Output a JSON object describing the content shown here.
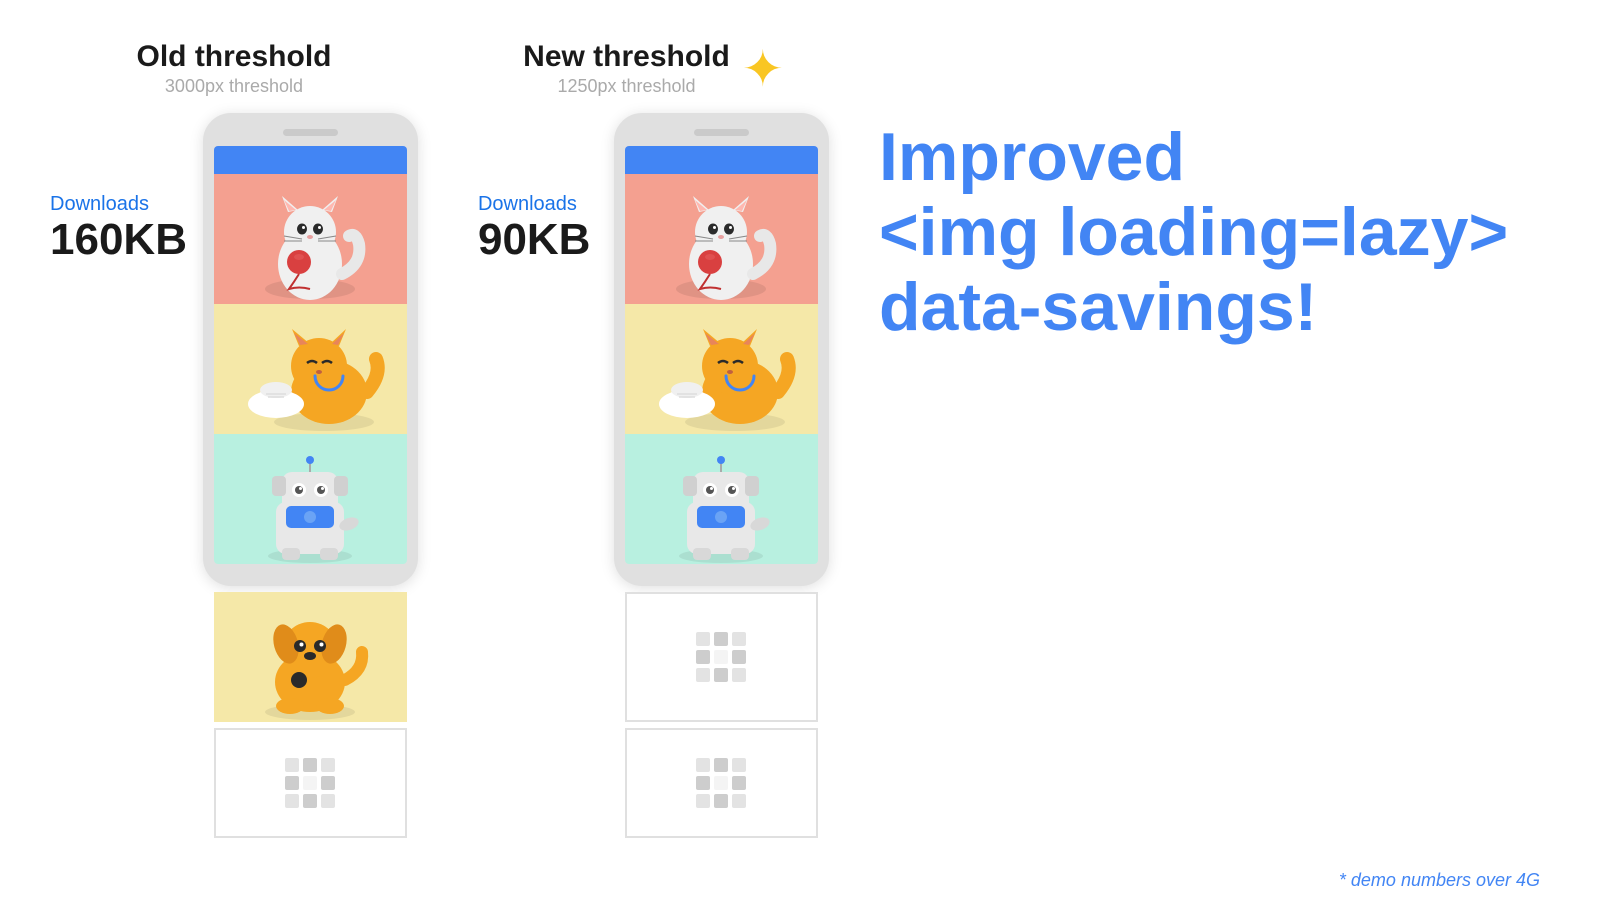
{
  "page": {
    "background": "#ffffff"
  },
  "left_section": {
    "threshold_title": "Old threshold",
    "threshold_subtitle": "3000px threshold",
    "download_label": "Downloads",
    "download_size": "160KB"
  },
  "right_section": {
    "threshold_title": "New threshold",
    "threshold_subtitle": "1250px threshold",
    "download_label": "Downloads",
    "download_size": "90KB"
  },
  "headline": {
    "line1": "Improved",
    "line2": "<img loading=lazy>",
    "line3": "data-savings!"
  },
  "footnote": "* demo numbers over 4G",
  "sparkle_icon": "✦",
  "loading_alt": "loading"
}
